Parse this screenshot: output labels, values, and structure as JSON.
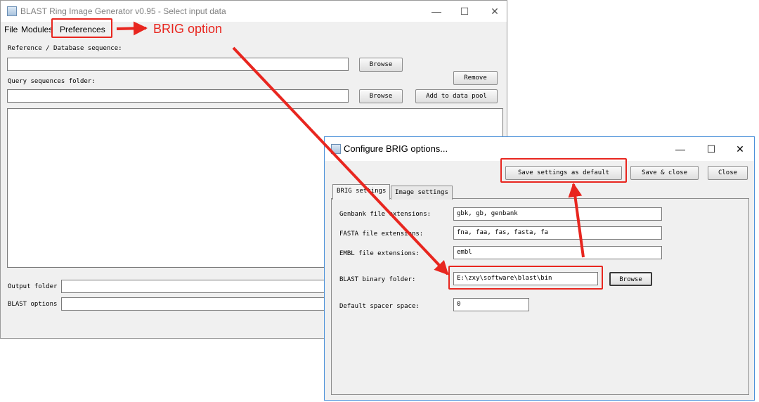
{
  "main_window": {
    "title": "BLAST Ring Image Generator v0.95 - Select input data",
    "menus": [
      "File",
      "Modules",
      "Preferences"
    ],
    "reference_label": "Reference / Database sequence:",
    "reference_value": "",
    "browse_label": "Browse",
    "remove_label": "Remove",
    "query_label": "Query sequences folder:",
    "query_value": "",
    "add_pool_label": "Add to data pool",
    "output_label": "Output folder",
    "output_value": "",
    "blast_options_label": "BLAST options",
    "blast_options_value": ""
  },
  "dialog": {
    "title": "Configure BRIG options...",
    "save_default_label": "Save settings as default",
    "save_close_label": "Save & close",
    "close_label": "Close",
    "tabs": [
      "BRIG settings",
      "Image settings"
    ],
    "genbank_label": "Genbank file extensions:",
    "genbank_value": "gbk, gb, genbank",
    "fasta_label": "FASTA file extensions:",
    "fasta_value": "fna, faa, fas, fasta, fa",
    "embl_label": "EMBL file extensions:",
    "embl_value": "embl",
    "blast_folder_label": "BLAST binary folder:",
    "blast_folder_value": "E:\\zxy\\software\\blast\\bin",
    "browse_label": "Browse",
    "spacer_label": "Default spacer space:",
    "spacer_value": "0"
  },
  "annotation": {
    "text": "BRIG option",
    "color": "#e8261f"
  },
  "icons": {
    "minimize": "—",
    "maximize": "☐",
    "close": "✕"
  }
}
